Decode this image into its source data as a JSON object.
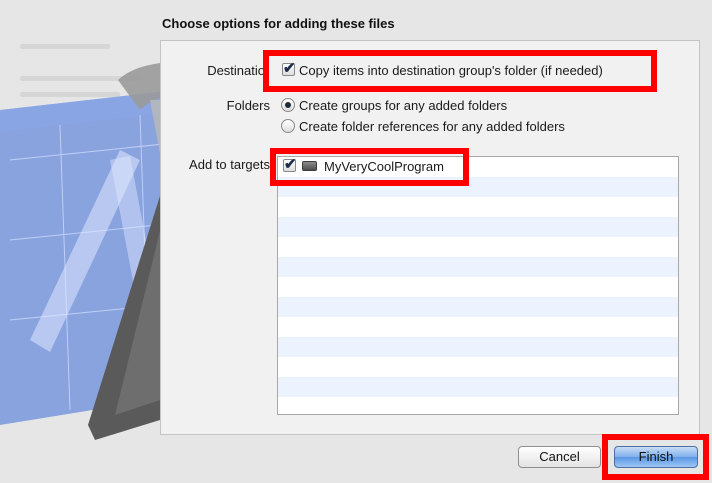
{
  "sheet": {
    "title": "Choose options for adding these files"
  },
  "destination": {
    "label": "Destinatio",
    "checkbox_label": "Copy items into destination group's folder (if needed)",
    "checked": true
  },
  "folders": {
    "label": "Folders",
    "options": [
      {
        "label": "Create groups for any added folders",
        "selected": true
      },
      {
        "label": "Create folder references for any added folders",
        "selected": false
      }
    ]
  },
  "targets": {
    "label": "Add to targets",
    "items": [
      {
        "name": "MyVeryCoolProgram",
        "checked": true
      }
    ]
  },
  "buttons": {
    "cancel": "Cancel",
    "finish": "Finish"
  },
  "colors": {
    "highlight": "#ff0000",
    "list_stripe": "#edf3fe",
    "primary_button": "#6aa4ea"
  }
}
